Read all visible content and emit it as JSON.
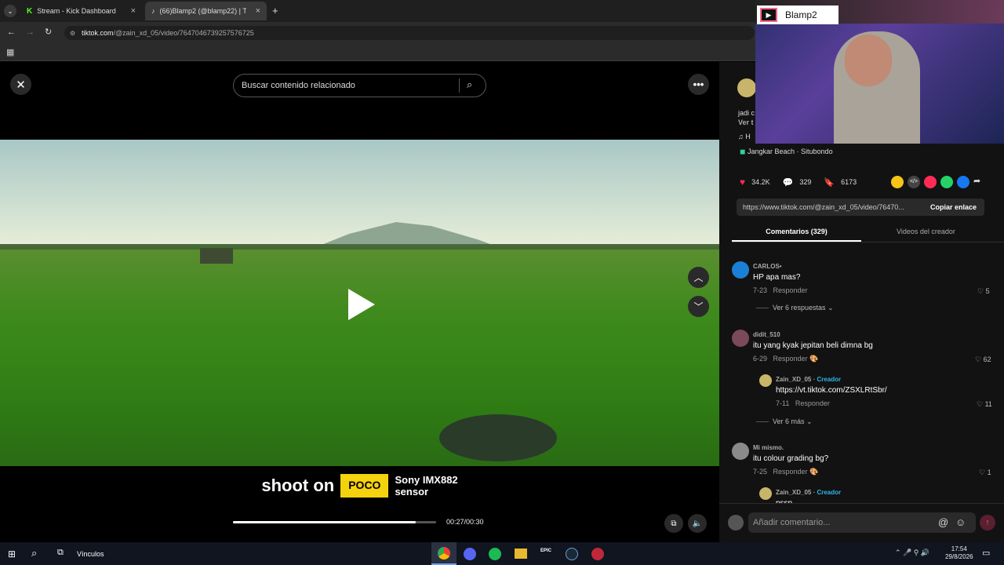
{
  "browser": {
    "tabs": [
      {
        "title": "Stream - Kick Dashboard",
        "active": false
      },
      {
        "title": "(66)Blamp2 (@blamp22) | TikTo",
        "active": true
      }
    ],
    "url_host": "tiktok.com",
    "url_path": "/@zain_xd_05/video/7647046739257576725"
  },
  "video": {
    "search_placeholder": "Buscar contenido relacionado",
    "caption_shoot": "shoot on",
    "caption_brand": "POCO",
    "caption_sensor_line1": "Sony IMX882",
    "caption_sensor_line2": "sensor",
    "time": "00:27/00:30",
    "progress": 0.9
  },
  "sidebar": {
    "desc_prefix": "jadi c",
    "ver_prefix": "Ver t",
    "music_prefix": "H",
    "location": "Jangkar Beach · Situbondo",
    "likes": "34.2K",
    "comments_count": "329",
    "saves": "6173",
    "share_url": "https://www.tiktok.com/@zain_xd_05/video/76470...",
    "copy_link": "Copiar enlace",
    "tab_comments": "Comentarios (329)",
    "tab_creator_videos": "Videos del creador",
    "comments": [
      {
        "user": "CARLOS•",
        "text": "HP apa mas?",
        "date": "7-23",
        "reply": "Responder",
        "likes": "5",
        "more": "Ver 6 respuestas"
      },
      {
        "user": "didit_510",
        "text": "itu yang kyak jepitan beli dimna bg",
        "date": "6-29",
        "reply": "Responder",
        "likes": "62"
      },
      {
        "user": "Zain_XD_05",
        "badge": "Creador",
        "text": "https://vt.tiktok.com/ZSXLRtSbr/",
        "date": "7-11",
        "reply": "Responder",
        "likes": "11",
        "more": "Ver 6 más"
      },
      {
        "user": "Mi mismo.",
        "text": "itu colour grading bg?",
        "date": "7-25",
        "reply": "Responder",
        "likes": "1"
      },
      {
        "user": "Zain_XD_05",
        "badge": "Creador",
        "text": "pssp"
      }
    ],
    "add_comment_placeholder": "Añadir comentario..."
  },
  "cam": {
    "title": "Blamp2"
  },
  "taskbar": {
    "vinculos": "Vínculos",
    "time": "17:54",
    "date": "29/8/2026"
  },
  "colors": {
    "creator": "#2fb5e8",
    "like": "#fe2c55"
  }
}
